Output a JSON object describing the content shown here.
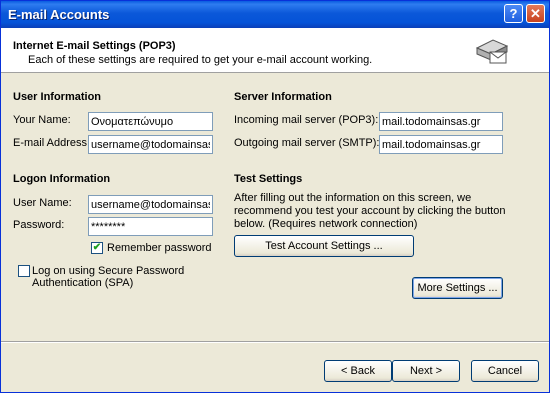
{
  "window": {
    "title": "E-mail Accounts",
    "help_glyph": "?",
    "close_glyph": "✕"
  },
  "header": {
    "title": "Internet E-mail Settings (POP3)",
    "subtitle": "Each of these settings are required to get your e-mail account working."
  },
  "user_info": {
    "heading": "User Information",
    "name_label": "Your Name:",
    "name_value": "Ονοματεπώνυμο",
    "email_label": "E-mail Address:",
    "email_value": "username@todomainsas.gr"
  },
  "server_info": {
    "heading": "Server Information",
    "incoming_label": "Incoming mail server (POP3):",
    "incoming_value": "mail.todomainsas.gr",
    "outgoing_label": "Outgoing mail server (SMTP):",
    "outgoing_value": "mail.todomainsas.gr"
  },
  "logon_info": {
    "heading": "Logon Information",
    "username_label": "User Name:",
    "username_value": "username@todomainsas.gr",
    "password_label": "Password:",
    "password_value": "********",
    "remember_label": "Remember password",
    "remember_checked": true,
    "spa_label_line1": "Log on using Secure Password",
    "spa_label_line2": "Authentication (SPA)",
    "spa_checked": false
  },
  "test_settings": {
    "heading": "Test Settings",
    "description_line1": "After filling out the information on this screen, we",
    "description_line2": "recommend you test your account by clicking the button",
    "description_line3": "below. (Requires network connection)",
    "test_button": "Test Account Settings ..."
  },
  "more_settings_button": "More Settings ...",
  "footer": {
    "back": "< Back",
    "next": "Next >",
    "cancel": "Cancel"
  },
  "icons": {
    "header": "mail-server-icon",
    "check": "✔"
  }
}
